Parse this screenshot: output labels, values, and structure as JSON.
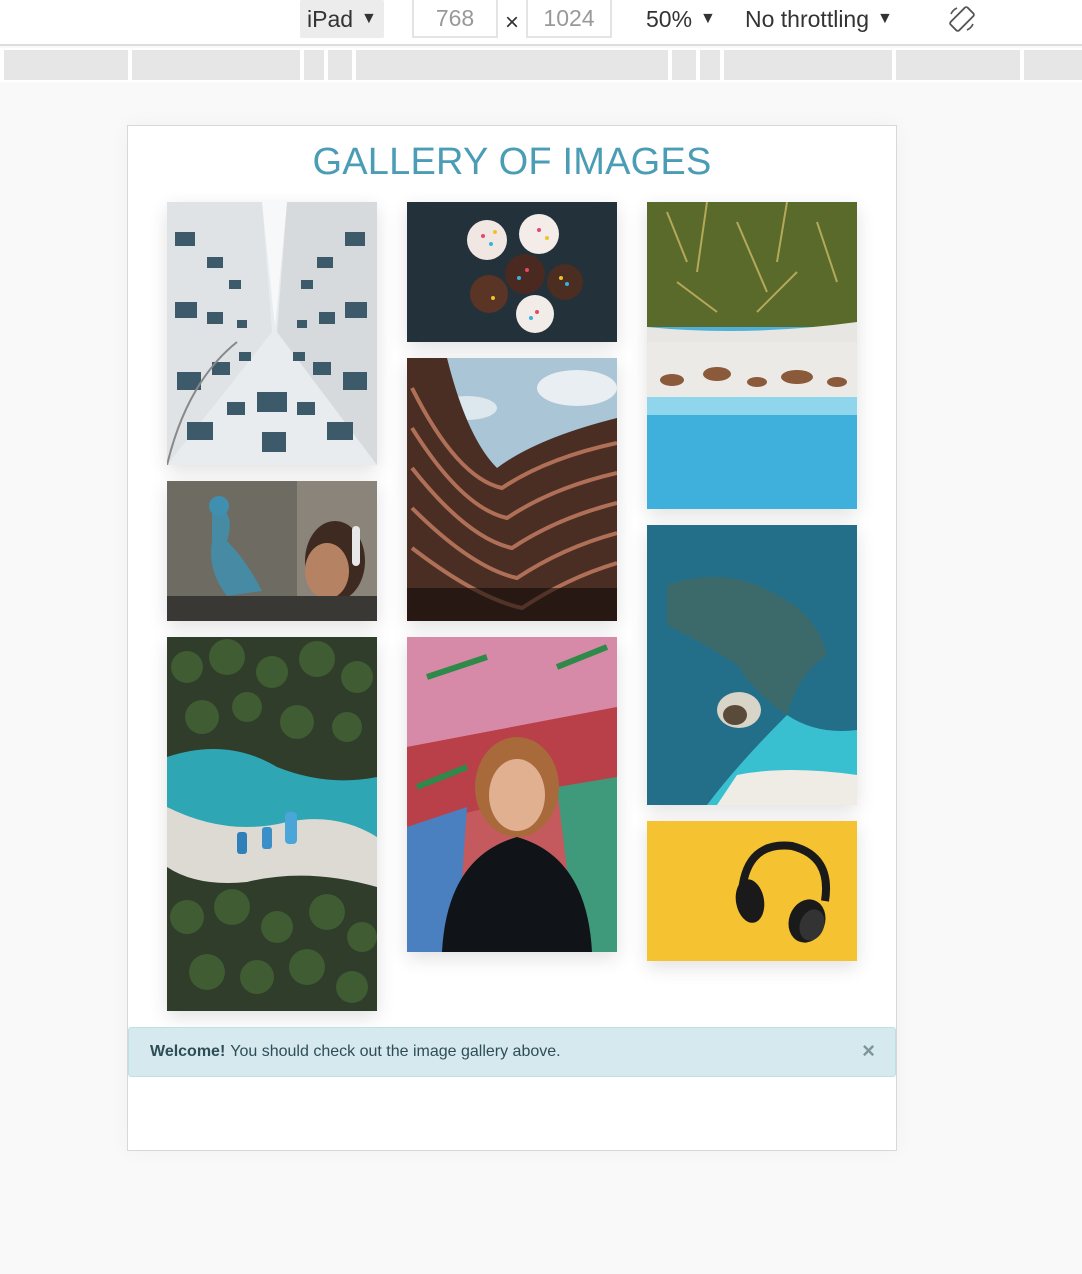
{
  "toolbar": {
    "device": "iPad",
    "width": "768",
    "height": "1024",
    "times": "×",
    "zoom": "50%",
    "throttling": "No throttling",
    "caret": "▼",
    "rotate_icon": "rotate-icon"
  },
  "page": {
    "title": "GALLERY OF IMAGES"
  },
  "gallery": {
    "images": [
      {
        "name": "building-facade-photo",
        "subject": "white building windows looking up"
      },
      {
        "name": "graffiti-girl-photo",
        "subject": "graffiti wall and person with headphones"
      },
      {
        "name": "palm-beach-aerial-photo",
        "subject": "aerial palm trees and boats"
      },
      {
        "name": "cupcakes-photo",
        "subject": "cupcakes with sprinkles"
      },
      {
        "name": "curved-building-photo",
        "subject": "curved brown building against sky"
      },
      {
        "name": "graffiti-portrait-photo",
        "subject": "person in black hoodie before graffiti"
      },
      {
        "name": "forest-beach-aerial-photo",
        "subject": "forest above beach and sea"
      },
      {
        "name": "reef-island-aerial-photo",
        "subject": "turquoise sea with rocky reef"
      },
      {
        "name": "headphones-photo",
        "subject": "black headphones on yellow"
      }
    ]
  },
  "alert": {
    "strong": "Welcome!",
    "text": "You should check out the image gallery above.",
    "close": "×"
  },
  "colors": {
    "title": "#4a9db5",
    "alert_bg": "#d6e9ee",
    "alert_text": "#2d4d57"
  }
}
